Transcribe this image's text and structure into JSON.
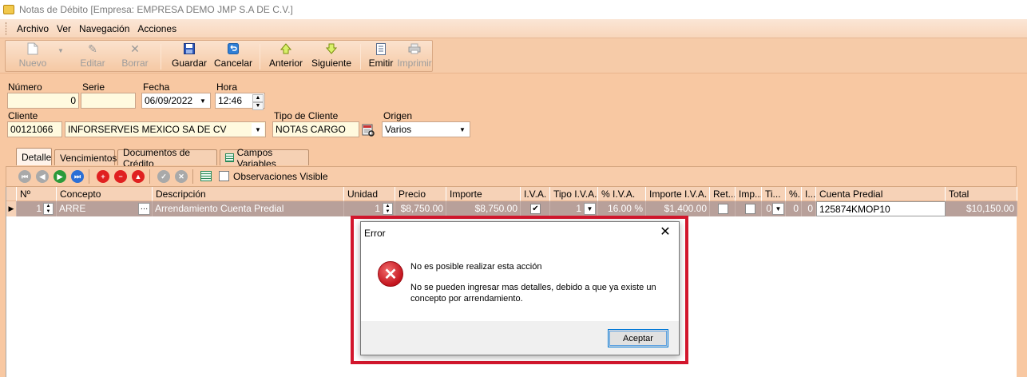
{
  "window": {
    "title": "Notas de Débito [Empresa: EMPRESA DEMO JMP S.A DE C.V.]"
  },
  "menu": {
    "archivo": "Archivo",
    "ver": "Ver",
    "navegacion": "Navegación",
    "acciones": "Acciones"
  },
  "toolbar": {
    "nuevo": "Nuevo",
    "editar": "Editar",
    "borrar": "Borrar",
    "guardar": "Guardar",
    "cancelar": "Cancelar",
    "anterior": "Anterior",
    "siguiente": "Siguiente",
    "emitir": "Emitir",
    "imprimir": "Imprimir"
  },
  "form": {
    "numero_label": "Número",
    "numero_value": "0",
    "serie_label": "Serie",
    "serie_value": "",
    "fecha_label": "Fecha",
    "fecha_value": "06/09/2022",
    "hora_label": "Hora",
    "hora_value": "12:46",
    "cliente_label": "Cliente",
    "cliente_code": "00121066",
    "cliente_name": "INFORSERVEIS MEXICO SA DE CV",
    "tipo_cliente_label": "Tipo de Cliente",
    "tipo_cliente_value": "NOTAS CARGO",
    "origen_label": "Origen",
    "origen_value": "Varios"
  },
  "tabs": {
    "detalle": "Detalle",
    "vencimientos": "Vencimientos",
    "documentos": "Documentos de Crédito",
    "campos": "Campos Variables"
  },
  "subtoolbar": {
    "observaciones": "Observaciones Visible"
  },
  "grid": {
    "headers": {
      "no": "Nº",
      "concepto": "Concepto",
      "descripcion": "Descripción",
      "unidad": "Unidad",
      "precio": "Precio",
      "importe": "Importe",
      "iva": "I.V.A.",
      "tipo_iva": "Tipo I.V.A.",
      "pct_iva": "% I.V.A.",
      "importe_iva": "Importe I.V.A.",
      "ret": "Ret...",
      "imp": "Imp...",
      "ti": "Ti...",
      "pct": "%...",
      "i": "I...",
      "cuenta_predial": "Cuenta Predial",
      "total": "Total"
    },
    "row": {
      "no": "1",
      "concepto": "ARRE",
      "descripcion": "Arrendamiento Cuenta Predial",
      "unidad": "1",
      "precio": "$8,750.00",
      "importe": "$8,750.00",
      "tipo_iva": "1",
      "pct_iva": "16.00 %",
      "importe_iva": "$1,400.00",
      "ti": "0",
      "pct": "0",
      "i": "0",
      "cuenta_predial": "125874KMOP10",
      "total": "$10,150.00"
    }
  },
  "dialog": {
    "title": "Error",
    "message1": "No es posible realizar esta acción",
    "message2": "No se pueden ingresar mas detalles, debido a que ya existe un concepto por arrendamiento.",
    "ok": "Aceptar"
  },
  "colors": {
    "form_bg": "#f8c8a2",
    "highlight_border": "#d3172d",
    "selected_row": "#b8a09a"
  }
}
